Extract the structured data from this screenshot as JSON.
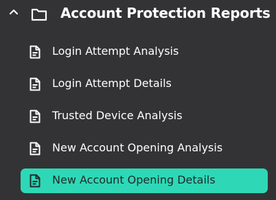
{
  "folder": {
    "title": "Account Protection Reports",
    "expanded": true,
    "caret_icon": "chevron-up-icon",
    "icon": "folder-icon"
  },
  "reports": [
    {
      "label": "Login Attempt Analysis",
      "icon": "document-icon",
      "selected": false
    },
    {
      "label": "Login Attempt Details",
      "icon": "document-icon",
      "selected": false
    },
    {
      "label": "Trusted Device Analysis",
      "icon": "document-icon",
      "selected": false
    },
    {
      "label": "New Account Opening Analysis",
      "icon": "document-icon",
      "selected": false
    },
    {
      "label": "New Account Opening Details",
      "icon": "document-icon",
      "selected": true
    }
  ],
  "colors": {
    "background": "#333335",
    "selected_background": "#2ed8b6",
    "text": "#ffffff",
    "selected_text": "#1f2a2a"
  }
}
